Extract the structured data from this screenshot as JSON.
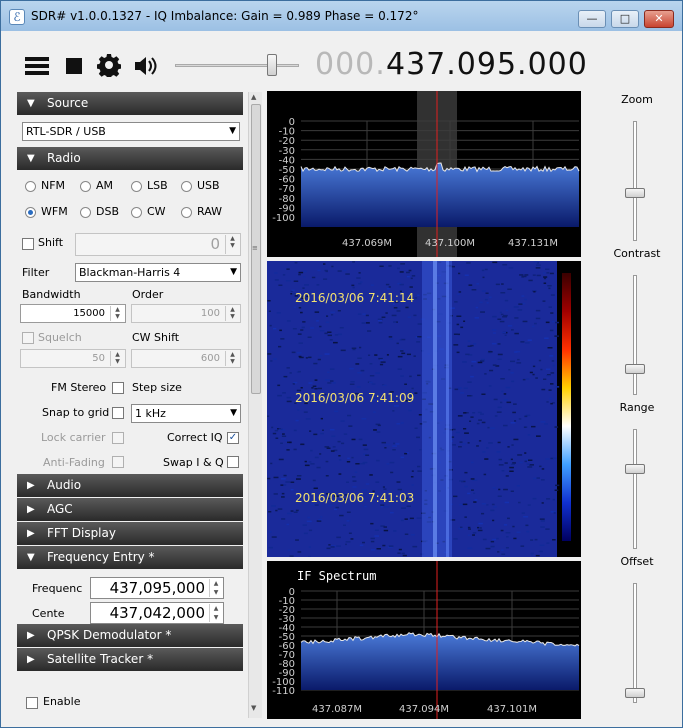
{
  "window": {
    "title": "SDR# v1.0.0.1327 - IQ Imbalance: Gain = 0.989 Phase = 0.172°",
    "min": "—",
    "max": "□",
    "close": "✕"
  },
  "toolbar": {
    "menu_icon": "menu-icon",
    "stop_icon": "stop-icon",
    "settings_icon": "gear-icon",
    "volume_icon": "speaker-icon",
    "frequency_prefix": "000.",
    "frequency_main": "437.095.000"
  },
  "sections": {
    "source": "Source",
    "radio": "Radio",
    "audio": "Audio",
    "agc": "AGC",
    "fft": "FFT Display",
    "freq_entry": "Frequency Entry *",
    "qpsk": "QPSK Demodulator *",
    "sat": "Satellite Tracker *"
  },
  "source": {
    "device": "RTL-SDR / USB"
  },
  "radio": {
    "modes_row1": [
      "NFM",
      "AM",
      "LSB",
      "USB"
    ],
    "modes_row2": [
      "WFM",
      "DSB",
      "CW",
      "RAW"
    ],
    "selected_mode": "WFM",
    "shift_label": "Shift",
    "shift_value": "0",
    "filter_label": "Filter",
    "filter_value": "Blackman-Harris 4",
    "bandwidth_label": "Bandwidth",
    "bandwidth_value": "15000",
    "order_label": "Order",
    "order_value": "100",
    "squelch_label": "Squelch",
    "squelch_value": "50",
    "cwshift_label": "CW Shift",
    "cwshift_value": "600",
    "fmstereo_label": "FM Stereo",
    "stepsize_label": "Step size",
    "snap_label": "Snap to grid",
    "snap_value": "1 kHz",
    "lockcarrier_label": "Lock carrier",
    "correctiq_label": "Correct IQ",
    "antifading_label": "Anti-Fading",
    "swapiq_label": "Swap I & Q"
  },
  "freq_entry": {
    "freq_label": "Frequenc",
    "freq_value": "437,095,000",
    "center_label": "Cente",
    "center_value": "437,042,000"
  },
  "bottom": {
    "enable_label": "Enable"
  },
  "spectrum": {
    "db_ticks": [
      "0",
      "-10",
      "-20",
      "-30",
      "-40",
      "-50",
      "-60",
      "-70",
      "-80",
      "-90",
      "-100"
    ],
    "x_ticks": [
      "437.069M",
      "437.100M",
      "437.131M"
    ]
  },
  "waterfall": {
    "timestamps": [
      "2016/03/06 7:41:14",
      "2016/03/06 7:41:09",
      "2016/03/06 7:41:03"
    ]
  },
  "if_spectrum": {
    "title": "IF Spectrum",
    "db_ticks": [
      "0",
      "-10",
      "-20",
      "-30",
      "-40",
      "-50",
      "-60",
      "-70",
      "-80",
      "-90",
      "-100",
      "-110"
    ],
    "x_ticks": [
      "437.087M",
      "437.094M",
      "437.101M"
    ]
  },
  "right_controls": {
    "zoom": "Zoom",
    "contrast": "Contrast",
    "range": "Range",
    "offset": "Offset"
  },
  "colors": {
    "section_header": "#3a3a3a",
    "spectrum_fill": "#2a5cb8",
    "tuning_line": "#e02020",
    "waterfall_bg": "#1a2a9a"
  }
}
